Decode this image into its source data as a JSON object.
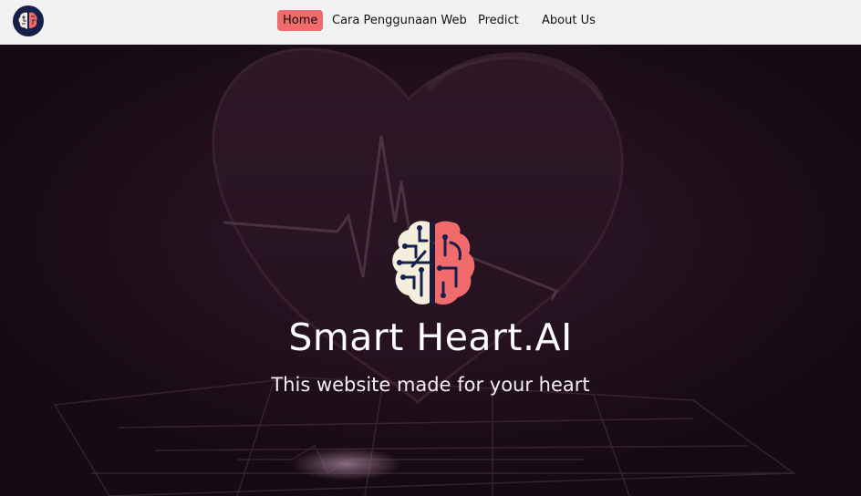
{
  "navbar": {
    "logo_icon": "brain-heart-logo-icon",
    "links": [
      {
        "label": "Home",
        "active": true
      },
      {
        "label": "Cara Penggunaan Web",
        "active": false
      },
      {
        "label": "Predict",
        "active": false
      },
      {
        "label": "About Us",
        "active": false
      }
    ],
    "active_color": "#f26b6b"
  },
  "hero": {
    "logo_icon": "brain-heart-logo-icon",
    "title": "Smart Heart.AI",
    "subtitle": "This website made for your heart",
    "background_image": "heart-ecg-monitor-image"
  },
  "colors": {
    "accent": "#f26b6b",
    "brain": "#f6eedc",
    "circuit": "#14204a",
    "hero_bg": "#1c0f19"
  }
}
